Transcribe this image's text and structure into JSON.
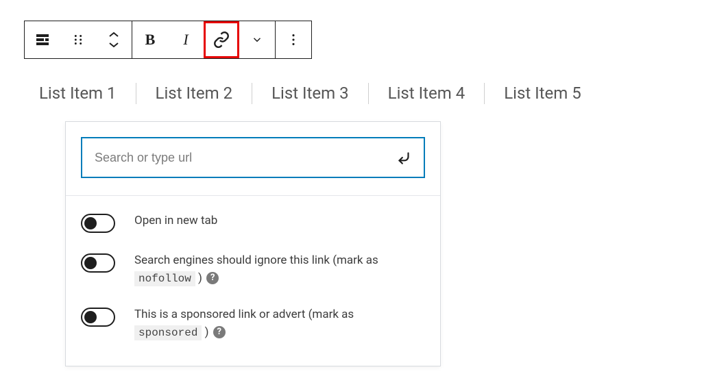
{
  "toolbar": {
    "buttons": {
      "transform": "Transform block",
      "drag": "Drag handle",
      "move": "Move up/down",
      "bold": "Bold",
      "italic": "Italic",
      "link": "Link",
      "dropdown": "More rich text controls",
      "options": "Options"
    }
  },
  "list_items": [
    "List Item 1",
    "List Item 2",
    "List Item 3",
    "List Item 4",
    "List Item 5"
  ],
  "link_popover": {
    "search_placeholder": "Search or type url",
    "options": {
      "new_tab": {
        "label": "Open in new tab"
      },
      "nofollow": {
        "text_before": "Search engines should ignore this link (mark as ",
        "code": "nofollow",
        "text_after": " )"
      },
      "sponsored": {
        "text_before": "This is a sponsored link or advert (mark as ",
        "code": "sponsored",
        "text_after": " )"
      }
    }
  }
}
